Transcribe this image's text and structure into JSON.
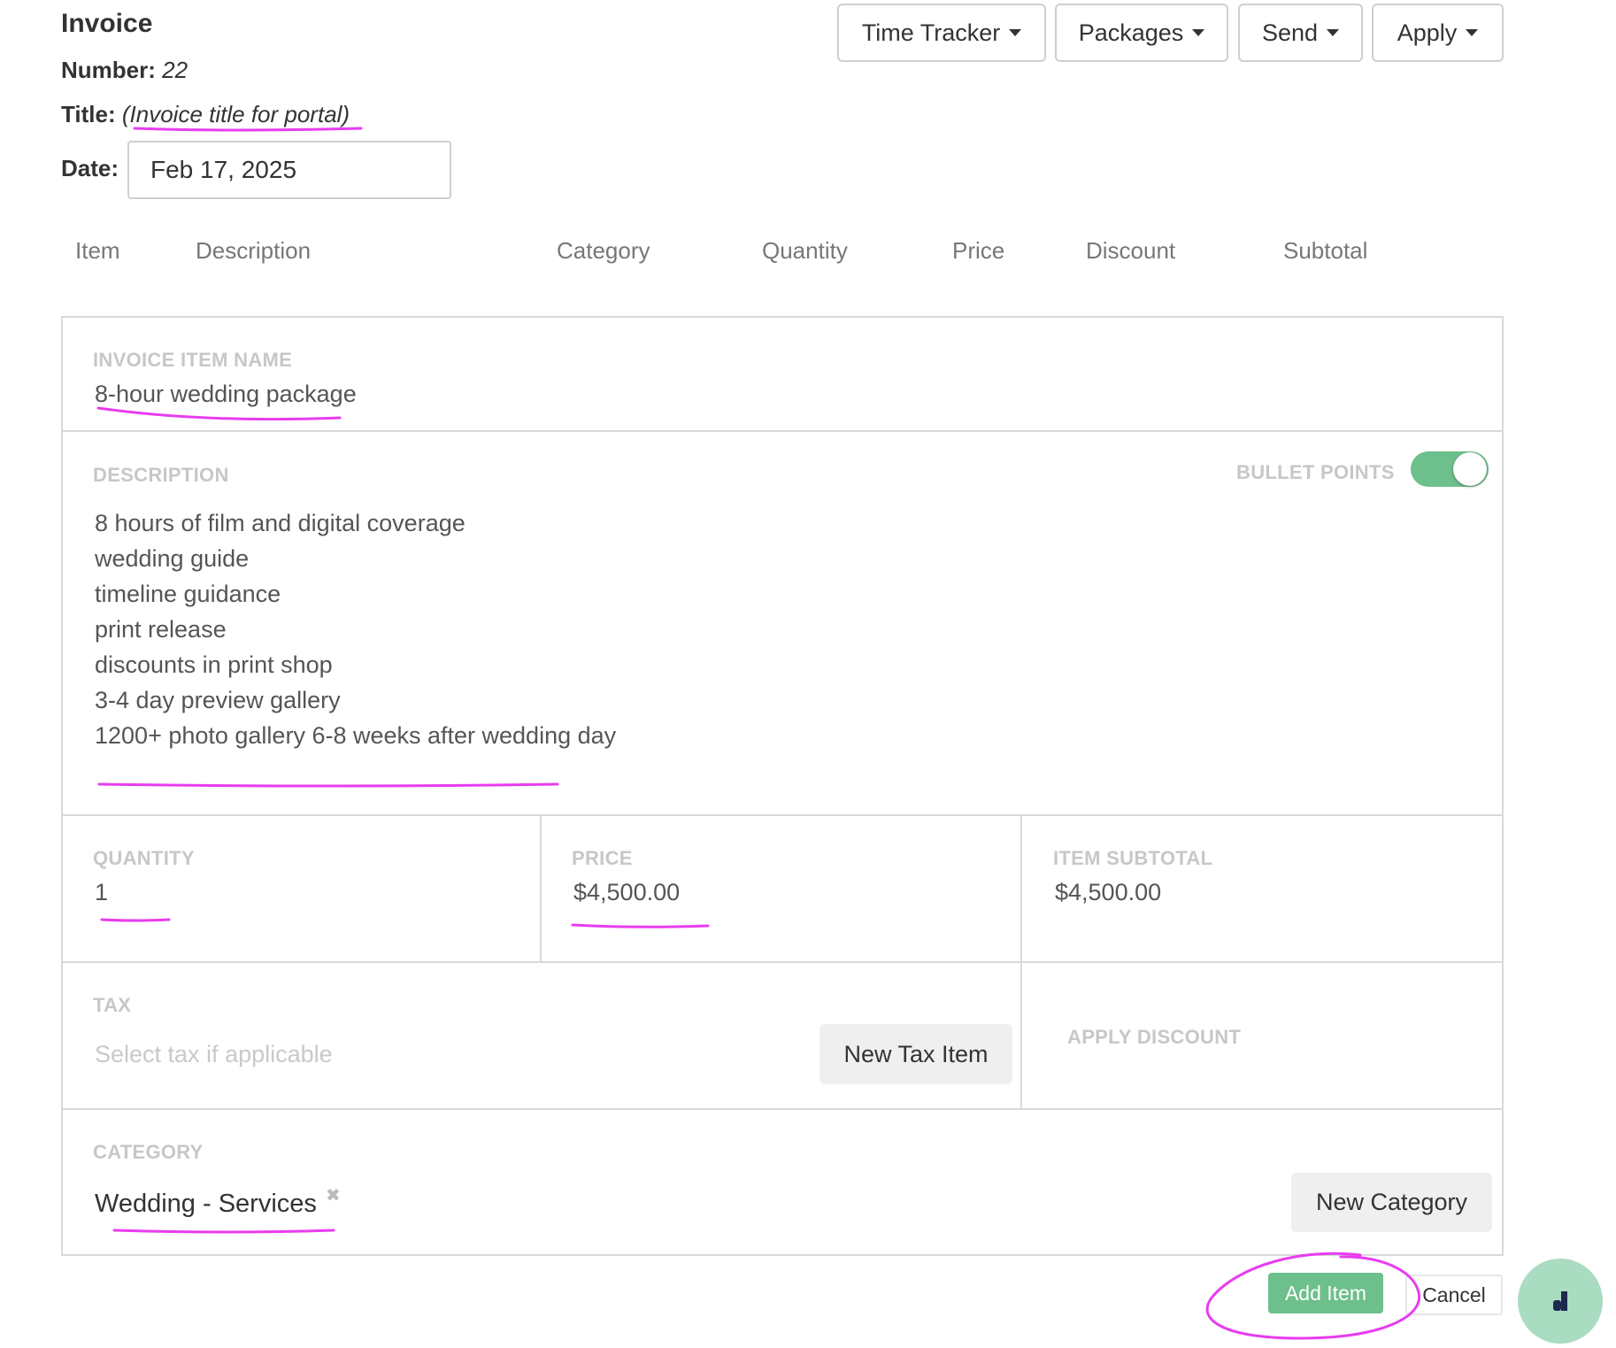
{
  "header": {
    "title": "Invoice",
    "number_label": "Number:",
    "number_value": "22",
    "title_label": "Title:",
    "title_value": "(Invoice title for portal)",
    "date_label": "Date:",
    "date_value": "Feb 17, 2025"
  },
  "toolbar": {
    "time_tracker": "Time Tracker",
    "packages": "Packages",
    "send": "Send",
    "apply": "Apply"
  },
  "columns": [
    "Item",
    "Description",
    "Category",
    "Quantity",
    "Price",
    "Discount",
    "Subtotal"
  ],
  "item": {
    "name_label": "INVOICE ITEM NAME",
    "name_value": "8-hour wedding package",
    "description_label": "DESCRIPTION",
    "bullet_points_label": "BULLET POINTS",
    "bullet_points_on": true,
    "description_lines": [
      "8 hours of film and digital coverage",
      "wedding guide",
      "timeline guidance",
      "print release",
      "discounts in print shop",
      "3-4 day preview gallery",
      "1200+ photo gallery 6-8 weeks after wedding day"
    ],
    "quantity_label": "QUANTITY",
    "quantity_value": "1",
    "price_label": "PRICE",
    "price_value": "$4,500.00",
    "subtotal_label": "ITEM SUBTOTAL",
    "subtotal_value": "$4,500.00",
    "tax_label": "TAX",
    "tax_placeholder": "Select tax if applicable",
    "new_tax_button": "New Tax Item",
    "discount_label": "APPLY DISCOUNT",
    "category_label": "CATEGORY",
    "category_value": "Wedding - Services",
    "new_category_button": "New Category"
  },
  "actions": {
    "add_item": "Add Item",
    "cancel": "Cancel"
  },
  "colors": {
    "accent_green": "#6dbf8b",
    "annotation_magenta": "#e83cf0",
    "chat_bg": "#a9dcc1",
    "chat_icon": "#1d2a4d"
  },
  "icons": {
    "dropdown": "caret-down-icon",
    "remove_category": "close-icon",
    "chat": "chat-widget-icon"
  }
}
